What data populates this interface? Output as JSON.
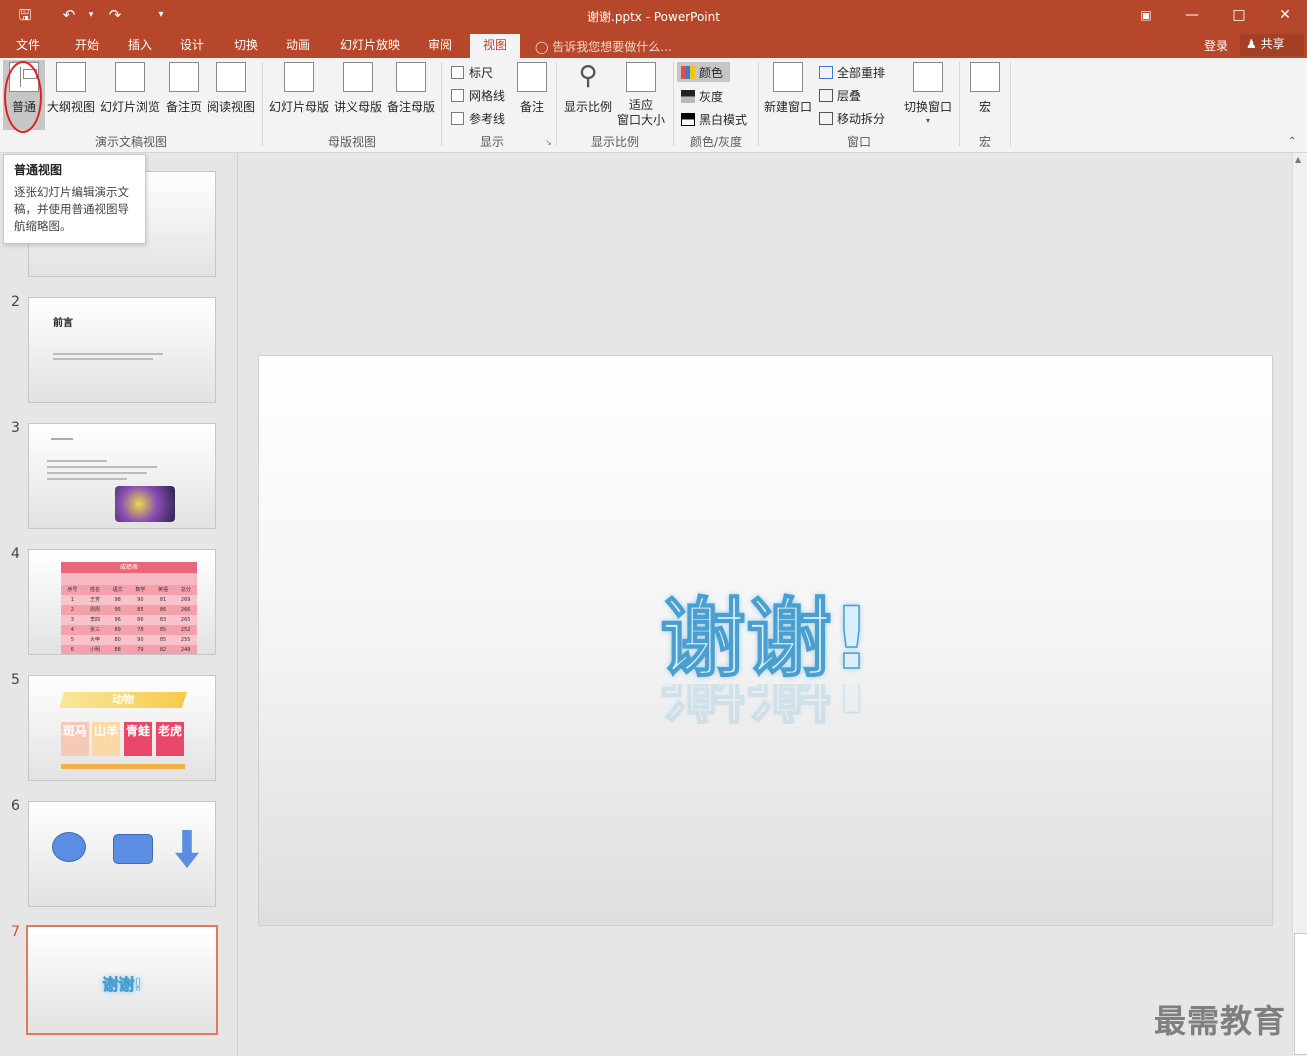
{
  "app": {
    "window_title": "谢谢.pptx - PowerPoint",
    "login": "登录",
    "share": "共享",
    "tell_me": "告诉我您想要做什么..."
  },
  "tabs": [
    "文件",
    "开始",
    "插入",
    "设计",
    "切换",
    "动画",
    "幻灯片放映",
    "审阅",
    "视图"
  ],
  "active_tab": "视图",
  "ribbon": {
    "presentation_views": {
      "label": "演示文稿视图",
      "buttons": [
        "普通",
        "大纲视图",
        "幻灯片浏览",
        "备注页",
        "阅读视图"
      ]
    },
    "master_views": {
      "label": "母版视图",
      "buttons": [
        "幻灯片母版",
        "讲义母版",
        "备注母版"
      ]
    },
    "show": {
      "label": "显示",
      "checks": [
        "标尺",
        "网格线",
        "参考线"
      ],
      "notes": "备注"
    },
    "zoom": {
      "label": "显示比例",
      "zoom": "显示比例",
      "fit_line1": "适应",
      "fit_line2": "窗口大小"
    },
    "color": {
      "label": "颜色/灰度",
      "items": [
        "颜色",
        "灰度",
        "黑白模式"
      ]
    },
    "window": {
      "label": "窗口",
      "new_window": "新建窗口",
      "items": [
        "全部重排",
        "层叠",
        "移动拆分"
      ],
      "switch": "切换窗口"
    },
    "macros": {
      "label": "宏",
      "button": "宏"
    }
  },
  "tooltip": {
    "title": "普通视图",
    "body": "逐张幻灯片编辑演示文稿，并使用普通视图导航缩略图。"
  },
  "slides": {
    "numbers": [
      "2",
      "3",
      "4",
      "5",
      "6",
      "7"
    ],
    "s2_title": "前言",
    "s4_title": "成绩表",
    "s4_headers": [
      "序号",
      "姓名",
      "语文",
      "数学",
      "英语",
      "总分"
    ],
    "s4_rows": [
      [
        "1",
        "王芳",
        "98",
        "90",
        "81",
        "269"
      ],
      [
        "2",
        "周周",
        "95",
        "85",
        "86",
        "266"
      ],
      [
        "3",
        "李四",
        "96",
        "86",
        "83",
        "265"
      ],
      [
        "4",
        "张三",
        "89",
        "78",
        "85",
        "252"
      ],
      [
        "5",
        "大甲",
        "80",
        "90",
        "85",
        "255"
      ],
      [
        "6",
        "小明",
        "88",
        "79",
        "82",
        "249"
      ]
    ],
    "s5_title": "动物",
    "s5_tiles": [
      "斑马",
      "山羊",
      "青蛙",
      "老虎"
    ],
    "s7_text": "谢谢!"
  },
  "main_slide_text": "谢谢!",
  "watermark": "最需教育",
  "colors": {
    "accent": "#b7472a",
    "selected_thumb_border": "#d35230",
    "wordart_outline": "#4a9fd0"
  }
}
